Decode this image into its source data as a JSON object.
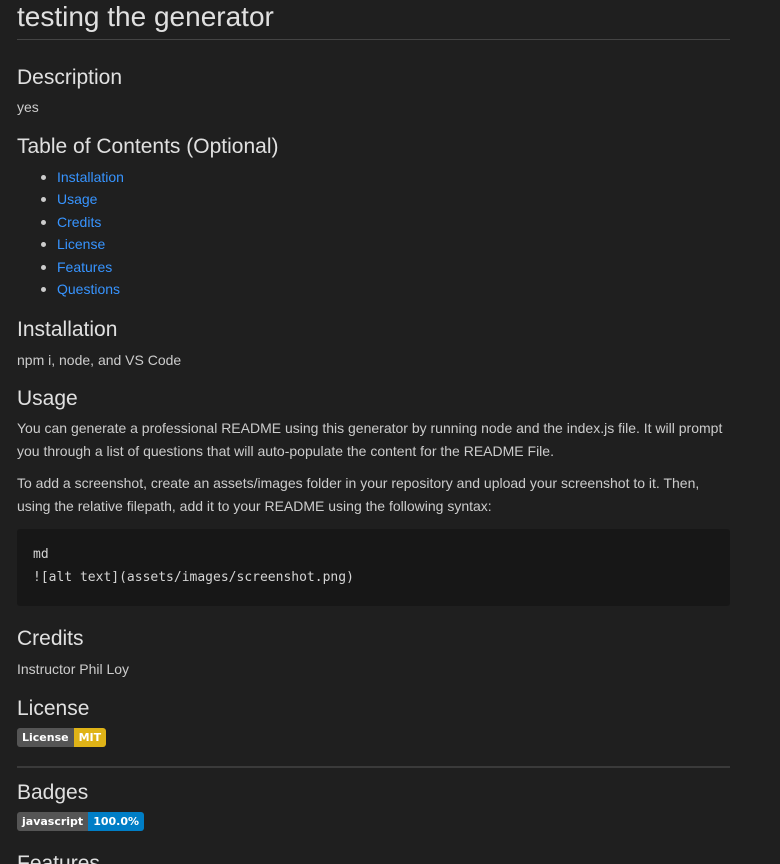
{
  "title": "testing the generator",
  "description": {
    "heading": "Description",
    "text": "yes"
  },
  "toc": {
    "heading": "Table of Contents (Optional)",
    "items": [
      "Installation",
      "Usage",
      "Credits",
      "License",
      "Features",
      "Questions"
    ]
  },
  "installation": {
    "heading": "Installation",
    "text": "npm i, node, and VS Code"
  },
  "usage": {
    "heading": "Usage",
    "para1": "You can generate a professional README using this generator by running node and the index.js file. It will prompt you through a list of questions that will auto-populate the content for the README File.",
    "para2": "To add a screenshot, create an assets/images folder in your repository and upload your screenshot to it. Then, using the relative filepath, add it to your README using the following syntax:",
    "code_line1": "md",
    "code_line2": "![alt text](assets/images/screenshot.png)"
  },
  "credits": {
    "heading": "Credits",
    "text": "Instructor Phil Loy"
  },
  "license": {
    "heading": "License",
    "badge_label": "License",
    "badge_value": "MIT",
    "badge_color": "#dfb317"
  },
  "badges": {
    "heading": "Badges",
    "badge_label": "javascript",
    "badge_value": "100.0%",
    "badge_color": "#007ec6"
  },
  "features": {
    "heading": "Features"
  },
  "colors": {
    "background": "#1f1f1f",
    "link": "#3794ff",
    "code_background": "#171717"
  }
}
